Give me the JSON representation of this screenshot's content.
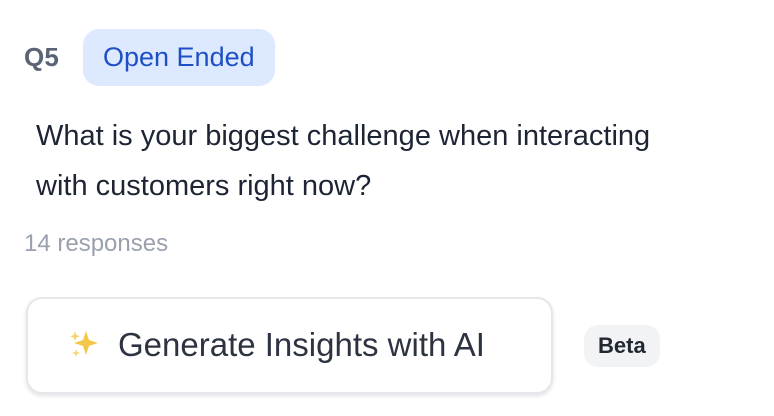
{
  "question": {
    "number": "Q5",
    "type_label": "Open Ended",
    "text": "What is your biggest challenge when interacting with customers right now?",
    "responses_text": "14 responses"
  },
  "insights": {
    "icon": "sparkles-icon",
    "button_label": "Generate Insights with AI",
    "beta_label": "Beta"
  },
  "colors": {
    "badge_bg": "#dce9ff",
    "badge_text": "#1f4fc4",
    "sparkle": "#f2c53d",
    "muted_text": "#9aa1ad"
  }
}
